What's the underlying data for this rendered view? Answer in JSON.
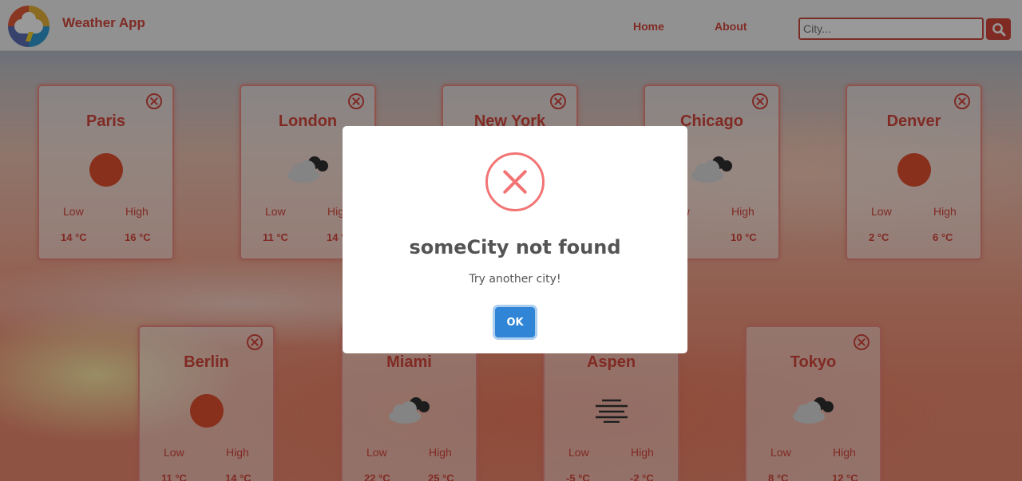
{
  "navbar": {
    "app_title": "Weather App",
    "logo_icon": "weather-logo-icon",
    "links": [
      {
        "label": "Home"
      },
      {
        "label": "About"
      }
    ],
    "search": {
      "placeholder": "City...",
      "value": "",
      "button_icon": "search-icon"
    }
  },
  "cards": [
    {
      "city": "Paris",
      "condition_icon": "sun-icon",
      "low_label": "Low",
      "high_label": "High",
      "low": "14 °C",
      "high": "16 °C"
    },
    {
      "city": "London",
      "condition_icon": "cloud-icon",
      "low_label": "Low",
      "high_label": "High",
      "low": "11 °C",
      "high": "14 °C"
    },
    {
      "city": "New York",
      "condition_icon": "cloud-icon",
      "low_label": "Low",
      "high_label": "High",
      "low": "",
      "high": ""
    },
    {
      "city": "Chicago",
      "condition_icon": "cloud-icon",
      "low_label": "Low",
      "high_label": "High",
      "low": "",
      "high": "10 °C"
    },
    {
      "city": "Denver",
      "condition_icon": "sun-icon",
      "low_label": "Low",
      "high_label": "High",
      "low": "2 °C",
      "high": "6 °C"
    },
    {
      "city": "Berlin",
      "condition_icon": "sun-icon",
      "low_label": "Low",
      "high_label": "High",
      "low": "11 °C",
      "high": "14 °C"
    },
    {
      "city": "Miami",
      "condition_icon": "cloud-icon",
      "low_label": "Low",
      "high_label": "High",
      "low": "22 °C",
      "high": "25 °C"
    },
    {
      "city": "Aspen",
      "condition_icon": "fog-icon",
      "low_label": "Low",
      "high_label": "High",
      "low": "-5 °C",
      "high": "-2 °C"
    },
    {
      "city": "Tokyo",
      "condition_icon": "cloud-icon",
      "low_label": "Low",
      "high_label": "High",
      "low": "8 °C",
      "high": "12 °C"
    }
  ],
  "modal": {
    "icon": "error-icon",
    "title": "someCity not found",
    "text": "Try another city!",
    "ok_label": "OK"
  },
  "colors": {
    "accent": "#d5473c",
    "sun": "#e4502f",
    "error": "#f27474",
    "ok_button": "#3085d6"
  }
}
